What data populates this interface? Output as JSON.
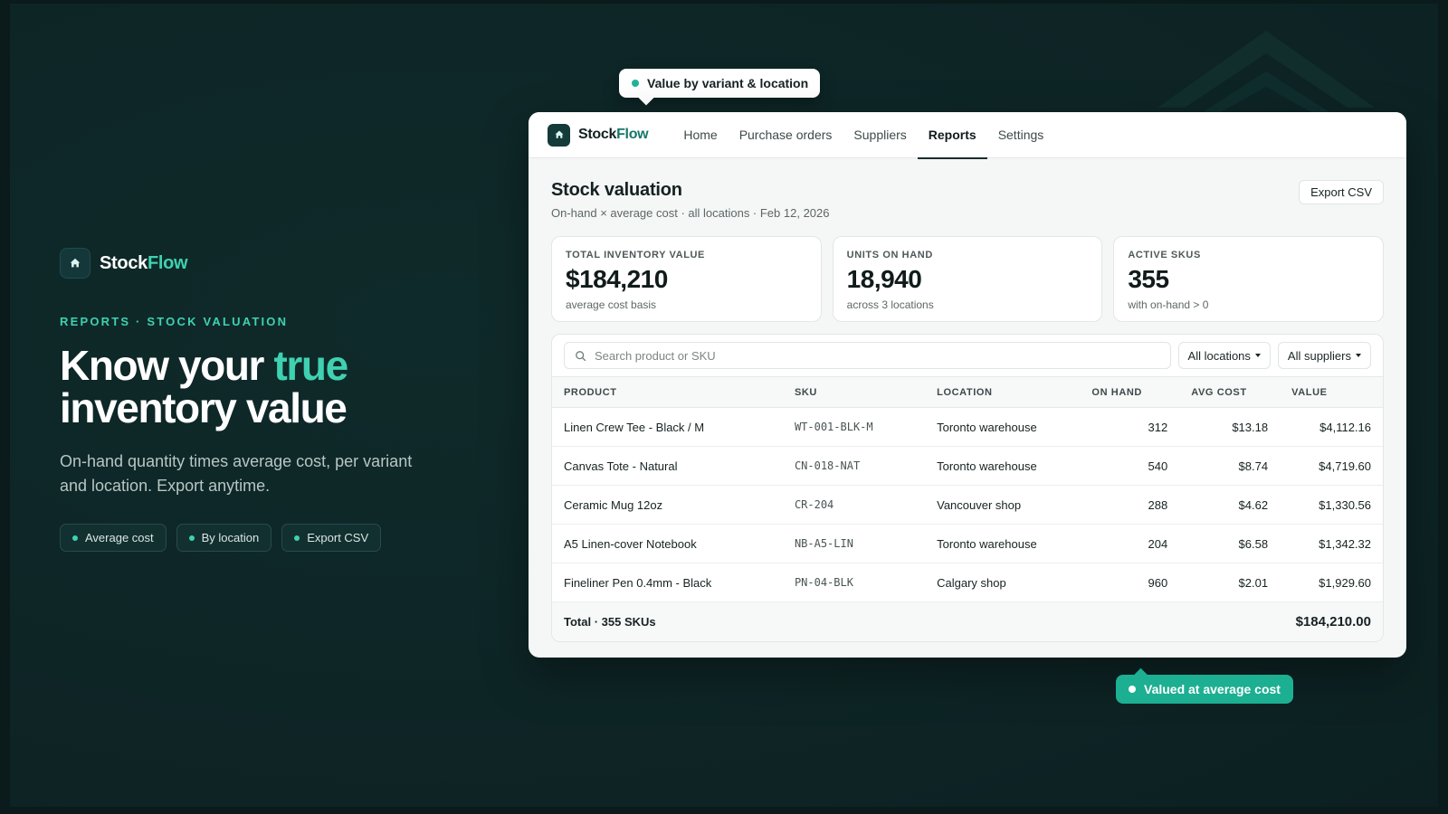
{
  "hero": {
    "brand_prefix": "Stock",
    "brand_suffix": "Flow",
    "eyebrow": "REPORTS · STOCK VALUATION",
    "headline_a": "Know your ",
    "headline_accent": "true",
    "headline_b": "inventory value",
    "subhead": "On-hand quantity times average cost, per variant and location. Export anytime.",
    "chips": [
      "Average cost",
      "By location",
      "Export CSV"
    ]
  },
  "callouts": {
    "top": "Value by variant & location",
    "bottom": "Valued at average cost"
  },
  "app": {
    "brand_prefix": "Stock",
    "brand_suffix": "Flow",
    "nav": [
      "Home",
      "Purchase orders",
      "Suppliers",
      "Reports",
      "Settings"
    ],
    "active_nav": "Reports",
    "title": "Stock valuation",
    "subtitle": "On-hand × average cost · all locations · Feb 12, 2026",
    "export_label": "Export CSV",
    "stats": [
      {
        "label": "TOTAL INVENTORY VALUE",
        "value": "$184,210",
        "note": "average cost basis"
      },
      {
        "label": "UNITS ON HAND",
        "value": "18,940",
        "note": "across 3 locations"
      },
      {
        "label": "ACTIVE SKUS",
        "value": "355",
        "note": "with on-hand > 0"
      }
    ],
    "search_placeholder": "Search product or SKU",
    "filters": [
      "All locations",
      "All suppliers"
    ],
    "columns": [
      "PRODUCT",
      "SKU",
      "LOCATION",
      "ON HAND",
      "AVG COST",
      "VALUE"
    ],
    "rows": [
      [
        "Linen Crew Tee - Black / M",
        "WT-001-BLK-M",
        "Toronto warehouse",
        "312",
        "$13.18",
        "$4,112.16"
      ],
      [
        "Canvas Tote - Natural",
        "CN-018-NAT",
        "Toronto warehouse",
        "540",
        "$8.74",
        "$4,719.60"
      ],
      [
        "Ceramic Mug 12oz",
        "CR-204",
        "Vancouver shop",
        "288",
        "$4.62",
        "$1,330.56"
      ],
      [
        "A5 Linen-cover Notebook",
        "NB-A5-LIN",
        "Toronto warehouse",
        "204",
        "$6.58",
        "$1,342.32"
      ],
      [
        "Fineliner Pen 0.4mm - Black",
        "PN-04-BLK",
        "Calgary shop",
        "960",
        "$2.01",
        "$1,929.60"
      ]
    ],
    "total_label": "Total · 355 SKUs",
    "total_value": "$184,210.00"
  },
  "colors": {
    "accent": "#3fd1b1",
    "background": "#0e2526",
    "callout_green": "#1daf92"
  },
  "icons": {
    "brand": "house-icon",
    "search": "search-icon",
    "dropdown": "caret-down-icon"
  }
}
